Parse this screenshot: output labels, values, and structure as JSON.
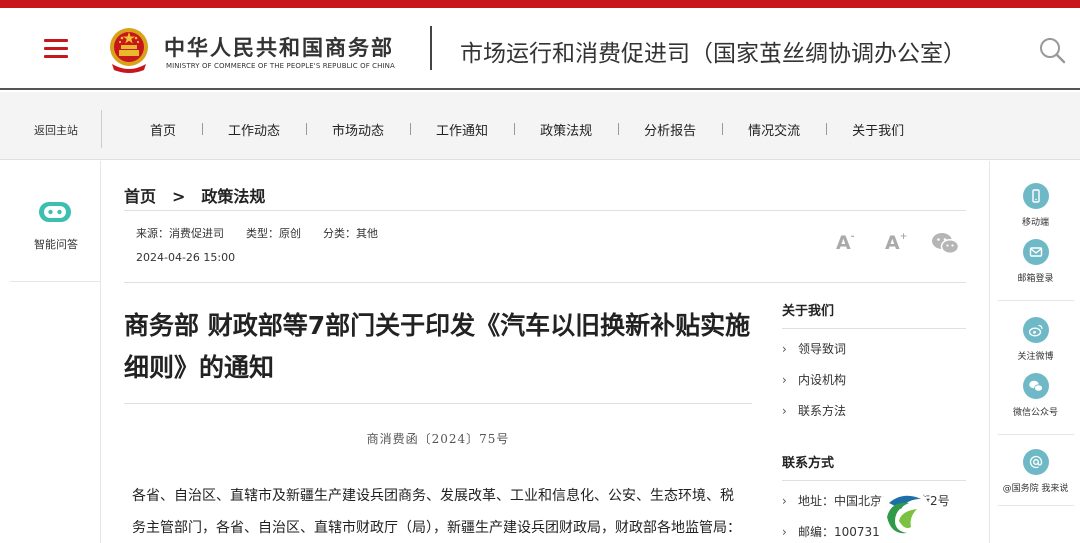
{
  "header": {
    "ministry_cn": "中华人民共和国商务部",
    "ministry_en": "MINISTRY OF COMMERCE OF THE PEOPLE'S REPUBLIC OF CHINA",
    "department": "市场运行和消费促进司（国家茧丝绸协调办公室）"
  },
  "nav": {
    "back": "返回主站",
    "items": [
      "首页",
      "工作动态",
      "市场动态",
      "工作通知",
      "政策法规",
      "分析报告",
      "情况交流",
      "关于我们"
    ]
  },
  "left_side": {
    "robot_label": "智能问答"
  },
  "right_side": {
    "items": [
      {
        "label": "移动端",
        "icon": "mobile-icon"
      },
      {
        "label": "邮箱登录",
        "icon": "mail-icon"
      },
      {
        "label": "关注微博",
        "icon": "weibo-icon"
      },
      {
        "label": "微信公众号",
        "icon": "wechat-icon"
      },
      {
        "label": "@国务院 我来说",
        "icon": "at-icon"
      }
    ]
  },
  "breadcrumb": {
    "home": "首页",
    "sep": ">",
    "current": "政策法规"
  },
  "meta": {
    "source": "来源：消费促进司",
    "type": "类型：原创",
    "category": "分类：其他",
    "date": "2024-04-26 15:00",
    "font_large": "A",
    "font_small": "A",
    "plus": "+",
    "minus": "-"
  },
  "article": {
    "title": "商务部 财政部等7部门关于印发《汽车以旧换新补贴实施细则》的通知",
    "doc_number": "商消费函〔2024〕75号",
    "body": "各省、自治区、直辖市及新疆生产建设兵团商务、发展改革、工业和信息化、公安、生态环境、税务主管部门，各省、自治区、直辖市财政厅（局），新疆生产建设兵团财政局，财政部各地监管局："
  },
  "sidebar": {
    "about_title": "关于我们",
    "about_items": [
      "领导致词",
      "内设机构",
      "联系方法"
    ],
    "contact_title": "联系方式",
    "contact_items": [
      "地址：中国北京东长安街2号",
      "邮编：100731"
    ]
  },
  "colors": {
    "brand_red": "#c8161d",
    "icon_teal": "#6fb9c7",
    "robot_teal": "#3bbfae"
  }
}
